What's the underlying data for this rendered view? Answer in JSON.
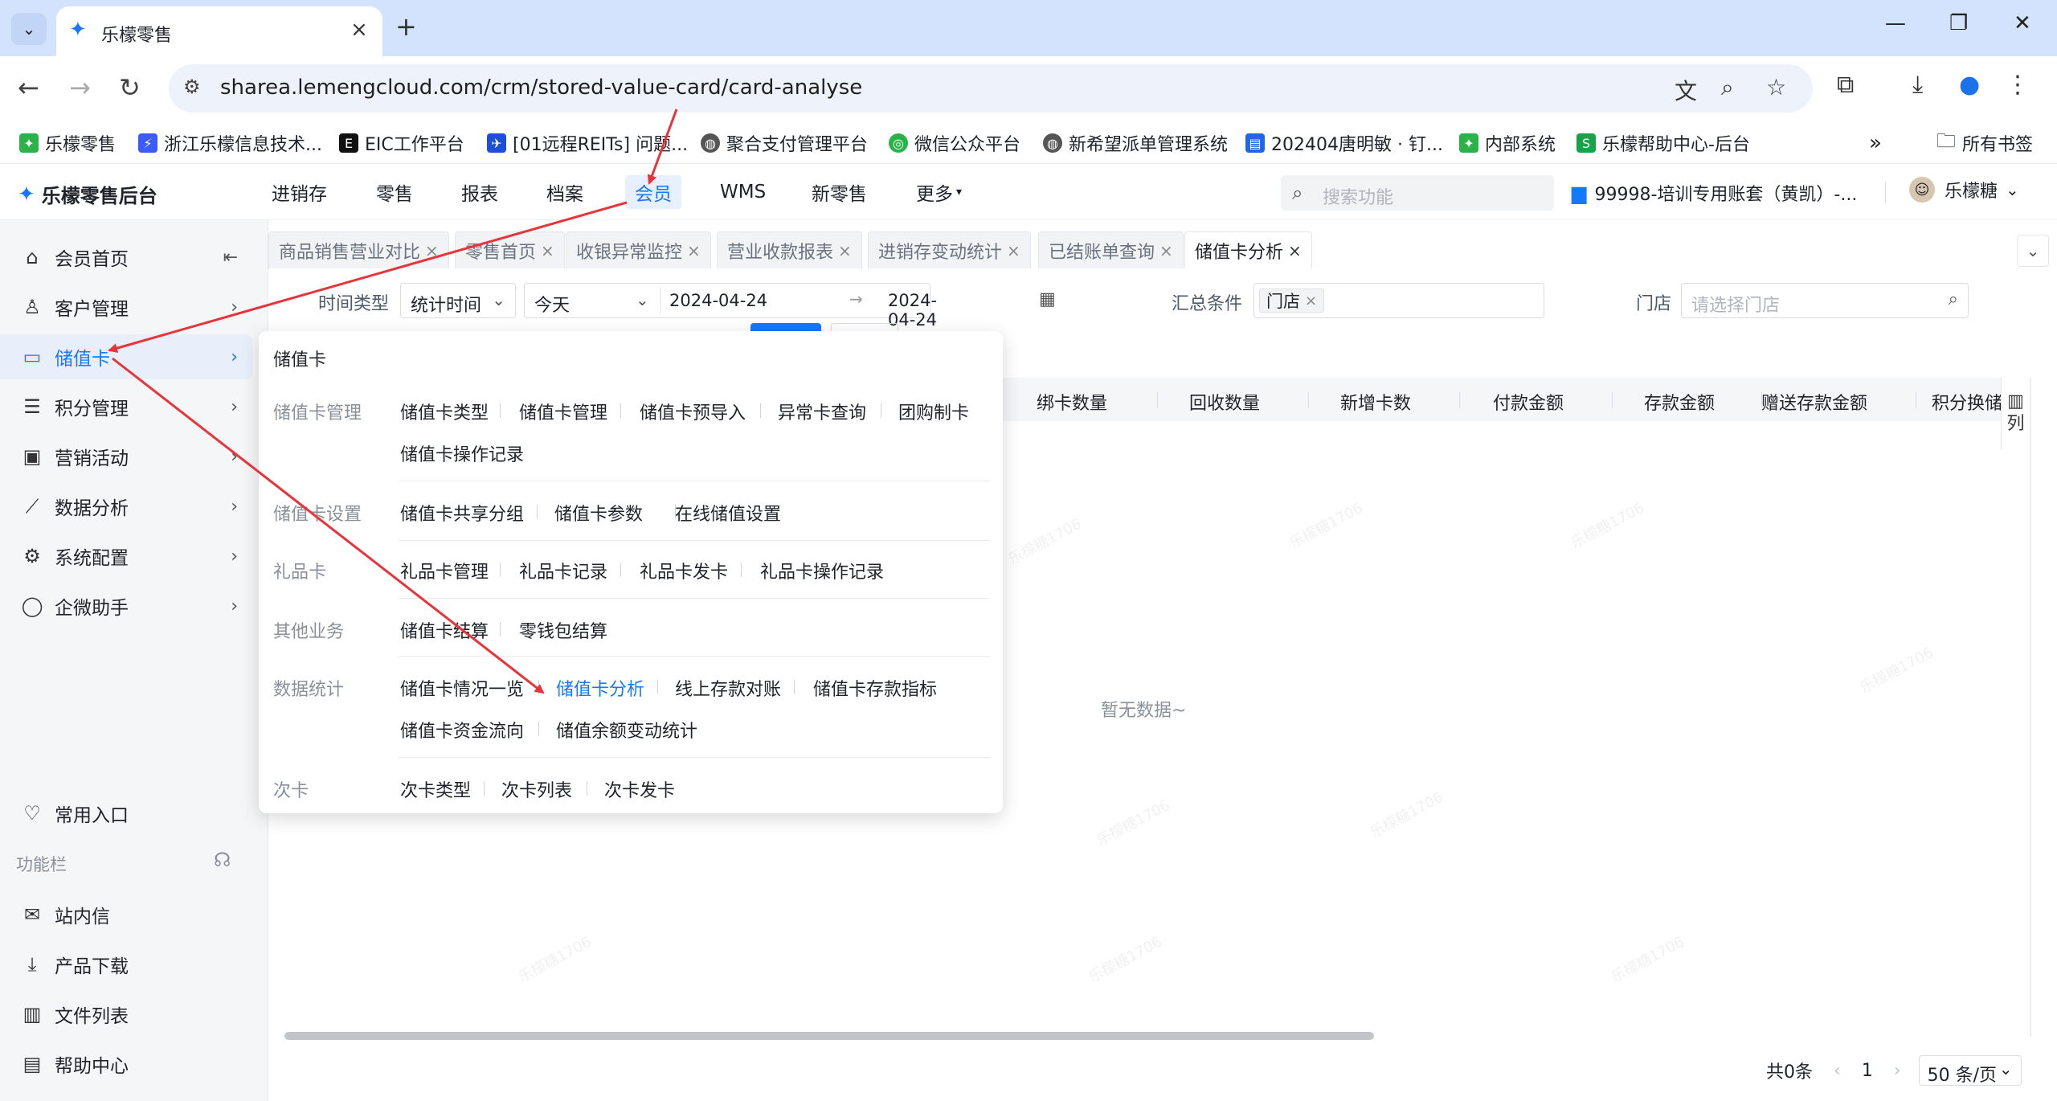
{
  "browser": {
    "tab_title": "乐檬零售",
    "url": "sharea.lemengcloud.com/crm/stored-value-card/card-analyse",
    "bookmarks": [
      "乐檬零售",
      "浙江乐檬信息技术...",
      "EIC工作平台",
      "[01远程REITs] 问题...",
      "聚合支付管理平台",
      "微信公众平台",
      "新希望派单管理系统",
      "202404唐明敏 · 钉...",
      "内部系统",
      "乐檬帮助中心-后台"
    ],
    "all_bookmarks": "所有书签"
  },
  "app": {
    "logo": "乐檬零售后台",
    "nav": [
      "进销存",
      "零售",
      "报表",
      "档案",
      "会员",
      "WMS",
      "新零售",
      "更多"
    ],
    "search_placeholder": "搜索功能",
    "account": "99998-培训专用账套（黄凯）-...",
    "user": "乐檬糖"
  },
  "sidebar": {
    "items": [
      "会员首页",
      "客户管理",
      "储值卡",
      "积分管理",
      "营销活动",
      "数据分析",
      "系统配置",
      "企微助手"
    ],
    "common": "常用入口",
    "func_label": "功能栏",
    "func_items": [
      "站内信",
      "产品下载",
      "文件列表",
      "帮助中心"
    ]
  },
  "worktabs": [
    "商品销售营业对比",
    "零售首页",
    "收银异常监控",
    "营业收款报表",
    "进销存变动统计",
    "已结账单查询",
    "储值卡分析"
  ],
  "filters": {
    "time_type_label": "时间类型",
    "time_type_value": "统计时间",
    "period_value": "今天",
    "date_start": "2024-04-24",
    "date_end": "2024-04-24",
    "summary_label": "汇总条件",
    "summary_tag": "门店",
    "store_label": "门店",
    "store_placeholder": "请选择门店"
  },
  "table": {
    "columns": [
      "绑卡数量",
      "回收数量",
      "新增卡数",
      "付款金额",
      "存款金额",
      "赠送存款金额",
      "积分换储"
    ],
    "column_setting": "列",
    "empty": "暂无数据~"
  },
  "pager": {
    "total": "共0条",
    "page": "1",
    "size": "50 条/页"
  },
  "menu": {
    "title": "储值卡",
    "groups": [
      {
        "label": "储值卡管理",
        "items": [
          "储值卡类型",
          "储值卡管理",
          "储值卡预导入",
          "异常卡查询",
          "团购制卡",
          "储值卡操作记录"
        ]
      },
      {
        "label": "储值卡设置",
        "items": [
          "储值卡共享分组",
          "储值卡参数",
          "在线储值设置"
        ]
      },
      {
        "label": "礼品卡",
        "items": [
          "礼品卡管理",
          "礼品卡记录",
          "礼品卡发卡",
          "礼品卡操作记录"
        ]
      },
      {
        "label": "其他业务",
        "items": [
          "储值卡结算",
          "零钱包结算"
        ]
      },
      {
        "label": "数据统计",
        "items": [
          "储值卡情况一览",
          "储值卡分析",
          "线上存款对账",
          "储值卡存款指标",
          "储值卡资金流向",
          "储值余额变动统计"
        ]
      },
      {
        "label": "次卡",
        "items": [
          "次卡类型",
          "次卡列表",
          "次卡发卡"
        ]
      }
    ]
  },
  "watermark": "乐檬糖1706",
  "colors": {
    "accent": "#1677ff",
    "arrow": "#e8333a"
  }
}
